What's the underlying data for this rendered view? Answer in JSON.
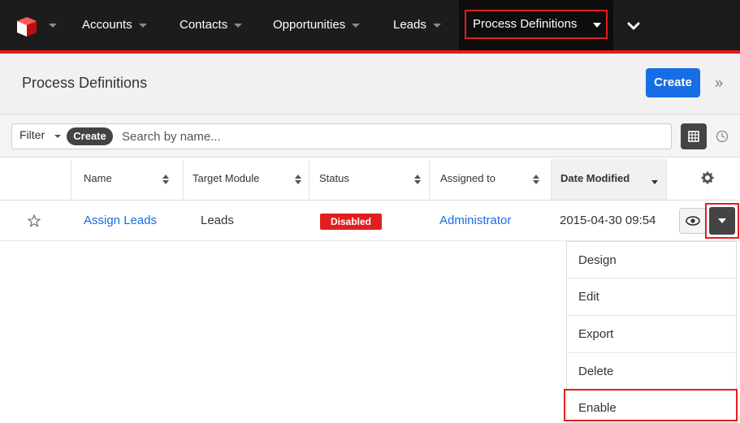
{
  "nav": {
    "items": [
      {
        "label": "Accounts"
      },
      {
        "label": "Contacts"
      },
      {
        "label": "Opportunities"
      },
      {
        "label": "Leads"
      }
    ],
    "active": {
      "label": "Process Definitions"
    }
  },
  "header": {
    "title": "Process Definitions",
    "create_label": "Create"
  },
  "filter": {
    "filter_label": "Filter",
    "create_label": "Create",
    "search_placeholder": "Search by name..."
  },
  "table": {
    "columns": [
      "Name",
      "Target Module",
      "Status",
      "Assigned to",
      "Date Modified"
    ],
    "rows": [
      {
        "name": "Assign Leads",
        "target_module": "Leads",
        "status": "Disabled",
        "assigned_to": "Administrator",
        "date_modified": "2015-04-30 09:54"
      }
    ]
  },
  "row_actions": {
    "items": [
      "Design",
      "Edit",
      "Export",
      "Delete",
      "Enable"
    ]
  },
  "colors": {
    "accent": "#176de5",
    "danger": "#e21f1f",
    "nav_bg": "#1c1c1c"
  }
}
